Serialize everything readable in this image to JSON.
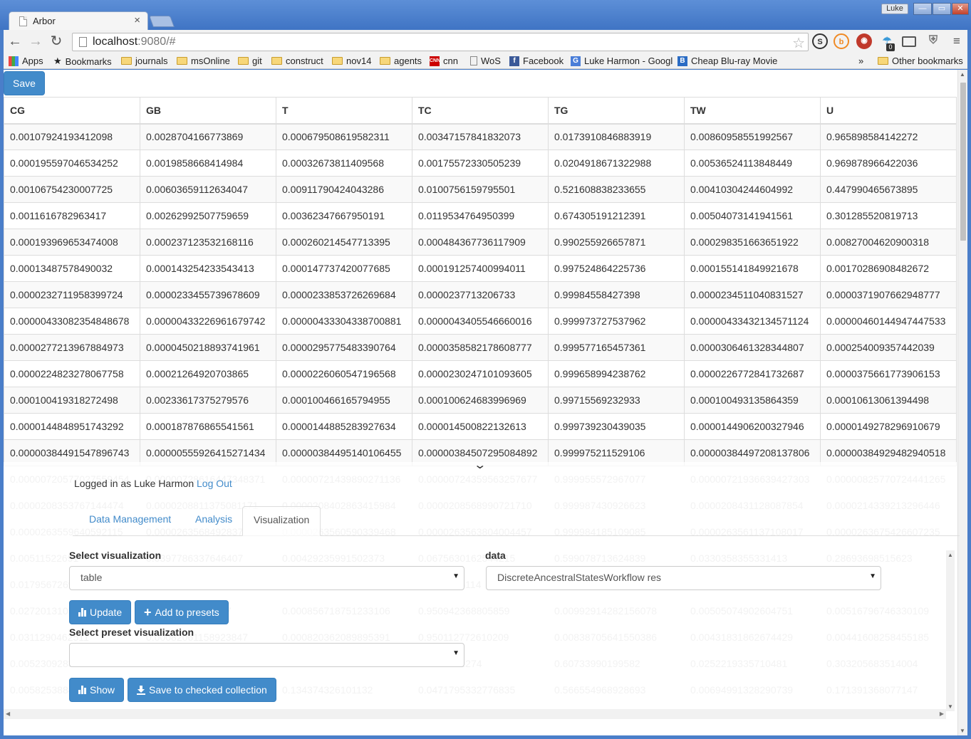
{
  "browser": {
    "tab_title": "Arbor",
    "tab_close": "×",
    "profile_name": "Luke",
    "url_host": "localhost",
    "url_rest": ":9080/#",
    "bookmarks": [
      {
        "label": "Apps",
        "icon": "apps-grid-icon"
      },
      {
        "label": "Bookmarks",
        "icon": "star-icon"
      },
      {
        "label": "journals",
        "icon": "folder-icon"
      },
      {
        "label": "msOnline",
        "icon": "folder-icon"
      },
      {
        "label": "git",
        "icon": "folder-icon"
      },
      {
        "label": "construct",
        "icon": "folder-icon"
      },
      {
        "label": "nov14",
        "icon": "folder-icon"
      },
      {
        "label": "agents",
        "icon": "folder-icon"
      },
      {
        "label": "cnn",
        "icon": "cnn-icon"
      },
      {
        "label": "WoS",
        "icon": "page-icon"
      },
      {
        "label": "Facebook",
        "icon": "facebook-icon"
      },
      {
        "label": "Luke Harmon - Googl",
        "icon": "google-scholar-icon"
      },
      {
        "label": "Cheap Blu-ray Movie",
        "icon": "blu-ray-icon"
      }
    ],
    "bookmarks_overflow": "»",
    "other_bookmarks": "Other bookmarks",
    "extension_badge": "0"
  },
  "page": {
    "save_label": "Save",
    "table": {
      "columns": [
        "CG",
        "GB",
        "T",
        "TC",
        "TG",
        "TW",
        "U"
      ],
      "rows": [
        [
          "0.00107924193412098",
          "0.0028704166773869",
          "0.000679508619582311",
          "0.00347157841832073",
          "0.0173910846883919",
          "0.00860958551992567",
          "0.965898584142272"
        ],
        [
          "0.000195597046534252",
          "0.0019858668414984",
          "0.00032673811409568",
          "0.00175572330505239",
          "0.0204918671322988",
          "0.00536524113848449",
          "0.969878966422036"
        ],
        [
          "0.00106754230007725",
          "0.00603659112634047",
          "0.00911790424043286",
          "0.0100756159795501",
          "0.521608838233655",
          "0.00410304244604992",
          "0.447990465673895"
        ],
        [
          "0.0011616782963417",
          "0.00262992507759659",
          "0.00362347667950191",
          "0.0119534764950399",
          "0.674305191212391",
          "0.00504073141941561",
          "0.301285520819713"
        ],
        [
          "0.000193969653474008",
          "0.000237123532168116",
          "0.000260214547713395",
          "0.000484367736117909",
          "0.990255926657871",
          "0.000298351663651922",
          "0.00827004620900318"
        ],
        [
          "0.00013487578490032",
          "0.000143254233543413",
          "0.000147737420077685",
          "0.000191257400994011",
          "0.997524864225736",
          "0.000155141849921678",
          "0.00170286908482672"
        ],
        [
          "0.0000232711958399724",
          "0.0000233455739678609",
          "0.0000233853726269684",
          "0.0000237713206733",
          "0.99984558427398",
          "0.0000234511040831527",
          "0.0000371907662948777"
        ],
        [
          "0.00000433082354848678",
          "0.00000433226961679742",
          "0.00000433304338700881",
          "0.0000043405546660016",
          "0.999973727537962",
          "0.00000433432134571124",
          "0.00000460144947447533"
        ],
        [
          "0.0000277213967884973",
          "0.0000450218893741961",
          "0.0000295775483390764",
          "0.0000358582178608777",
          "0.999577165457361",
          "0.0000306461328344807",
          "0.000254009357442039"
        ],
        [
          "0.0000224823278067758",
          "0.00021264920703865",
          "0.0000226060547196568",
          "0.0000230247101093605",
          "0.999658994238762",
          "0.0000226772841732687",
          "0.0000375661773906153"
        ],
        [
          "0.000100419318272498",
          "0.00233617375279576",
          "0.000100466165794955",
          "0.000100624683996969",
          "0.99715569232933",
          "0.000100493135864359",
          "0.00010613061394498"
        ],
        [
          "0.0000144848951743292",
          "0.000187876865541561",
          "0.0000144885283927634",
          "0.000014500822132613",
          "0.999739230439035",
          "0.0000144906200327946",
          "0.0000149278296910679"
        ],
        [
          "0.00000384491547896743",
          "0.00000555926415271434",
          "0.00000384495140106455",
          "0.00000384507295084892",
          "0.999975211529106",
          "0.00000384497208137806",
          "0.00000384929482940518"
        ]
      ],
      "faded_rows": [
        [
          "0.00000720577027559454",
          "0.00000728616447348371",
          "0.00000721439890271136",
          "0.00000724359563257677",
          "0.999955572967077",
          "0.00000721936639427303",
          "0.00000825770724441265"
        ],
        [
          "0.0000208353767144474",
          "0.0000208811375081171",
          "0.0000208402863415984",
          "0.0000208568990721710",
          "0.999987430926623",
          "0.0000208431128087854",
          "0.0000214339213296446"
        ],
        [
          "0.0000263559640592115",
          "0.0000263568492837",
          "0.0000263560590339468",
          "0.0000263563804004457",
          "0.999984185109085",
          "0.0000263561137108017",
          "0.0000263675426607235"
        ],
        [
          "0.00511522691",
          "0.0397786337646407",
          "0.00429235991502373",
          "0.0675630162544215",
          "0.599078713624839",
          "0.0330358355331413",
          "0.28693698515623"
        ],
        [
          "0.0179567269",
          "0.0219564612",
          "0.0176456746",
          "0.0186246114",
          "0.87914527",
          "0.0176819455",
          "0.10942225"
        ],
        [
          "0.0272013107",
          "0.00090163411307",
          "0.000856718751233106",
          "0.950942368805859",
          "0.00992914282156078",
          "0.00505074902604751",
          "0.00516796746330109"
        ],
        [
          "0.0311290462511",
          "0.00082061158923847",
          "0.000820362089895391",
          "0.950112772610209",
          "0.00838705641550386",
          "0.00431831862674429",
          "0.00441608258455185"
        ],
        [
          "0.00523092831",
          "0.1037004641",
          "0.0673452274",
          "0.0073452274",
          "0.60733990199582",
          "0.0252219335710481",
          "0.303205683514004"
        ],
        [
          "0.00582538841",
          "0.07495114",
          "0.134374326101132",
          "0.0471795332776835",
          "0.566554968928693",
          "0.00694991328290739",
          "0.171391368077147"
        ]
      ]
    },
    "panel": {
      "logged_in_prefix": "Logged in as Luke Harmon",
      "logout_label": "Log Out",
      "tabs": [
        "Data Management",
        "Analysis",
        "Visualization"
      ],
      "active_tab": "Visualization",
      "select_visualization_label": "Select visualization",
      "visualization_value": "table",
      "data_label": "data",
      "data_value": "DiscreteAncestralStatesWorkflow res",
      "update_label": "Update",
      "add_presets_label": "Add to presets",
      "preset_label": "Select preset visualization",
      "preset_value": "",
      "show_label": "Show",
      "save_collection_label": "Save to checked collection"
    }
  },
  "colors": {
    "primary": "#428bca",
    "link": "#428bca",
    "titlebar": "#4a7ec9"
  }
}
